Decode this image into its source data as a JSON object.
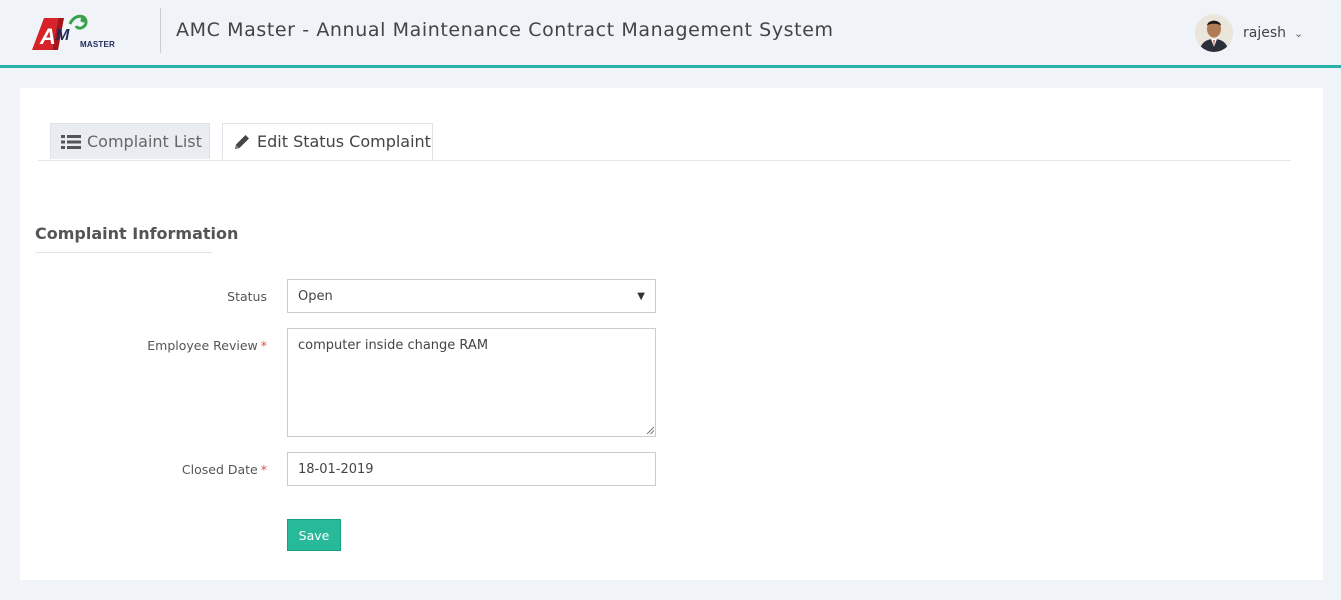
{
  "header": {
    "logo_text": "AMC",
    "logo_sub": "MASTER",
    "app_title": "AMC Master - Annual Maintenance Contract Management System",
    "user_name": "rajesh",
    "user_caret": "⌄"
  },
  "tabs": {
    "list_label": "Complaint List",
    "edit_label": "Edit Status Complaint"
  },
  "section": {
    "title": "Complaint Information"
  },
  "form": {
    "status_label": "Status",
    "status_value": "Open",
    "review_label": "Employee Review",
    "review_value": "computer inside change RAM",
    "closed_date_label": "Closed Date",
    "closed_date_value": "18-01-2019",
    "required_mark": "*",
    "save_label": "Save"
  },
  "colors": {
    "accent": "#2ab1a8",
    "save_button": "#26b99a",
    "required": "#d9534f"
  },
  "icons": {
    "list_tab": "list-icon",
    "edit_tab": "pencil-icon",
    "select": "dropdown-arrow-icon"
  }
}
